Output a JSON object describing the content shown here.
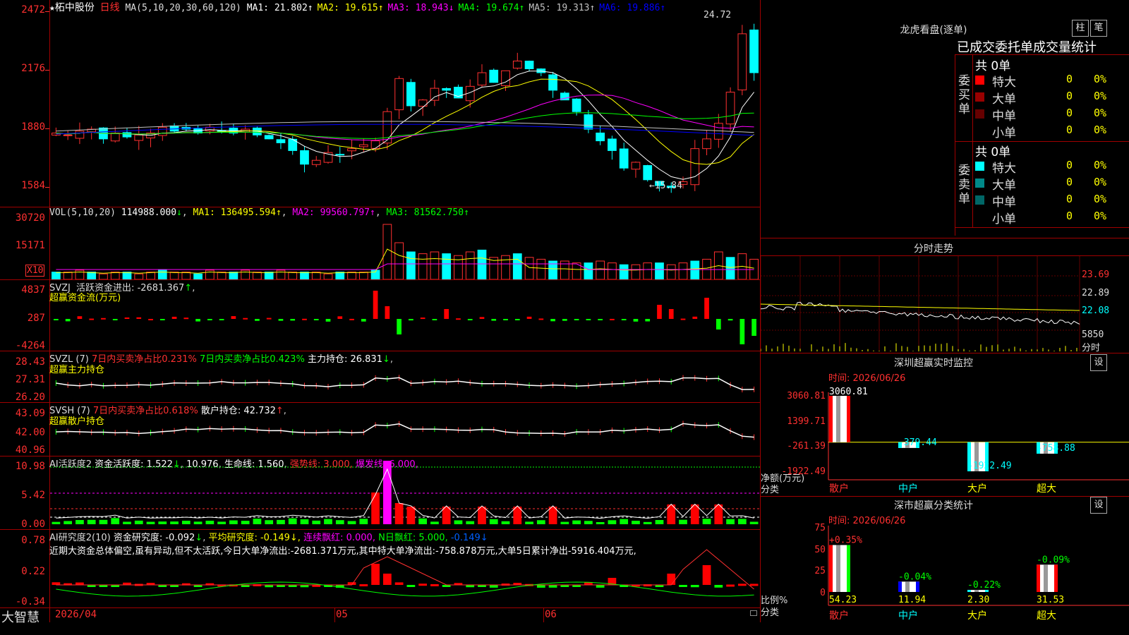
{
  "stock": {
    "name": "柘中股份",
    "period": "日线"
  },
  "main_chart": {
    "ma_params": "MA(5,10,20,30,60,120)",
    "ma_values": [
      {
        "label": "MA1:",
        "value": "21.802",
        "arrow": "↑",
        "color": "#ffffff"
      },
      {
        "label": "MA2:",
        "value": "19.615",
        "arrow": "↑",
        "color": "#ffff00"
      },
      {
        "label": "MA3:",
        "value": "18.943",
        "arrow": "↓",
        "color": "#ff00ff"
      },
      {
        "label": "MA4:",
        "value": "19.674",
        "arrow": "↑",
        "color": "#00ff00"
      },
      {
        "label": "MA5:",
        "value": "19.313",
        "arrow": "↑",
        "color": "#c0c0c0"
      },
      {
        "label": "MA6:",
        "value": "19.886",
        "arrow": "↑",
        "color": "#0000ff"
      }
    ],
    "y_ticks": [
      "2472",
      "2176",
      "1880",
      "1584"
    ],
    "high_label": "24.72",
    "low_label": "15.84"
  },
  "vol": {
    "title": "VOL(5,10,20)",
    "value": "114988.000",
    "ma1": "136495.594",
    "ma2": "99560.797",
    "ma3": "81562.750",
    "y_ticks": [
      "30720",
      "15171"
    ],
    "unit": "X10"
  },
  "svzj": {
    "title": "SVZJ",
    "label": "活跃资金进出:",
    "value": "-2681.367",
    "sub": "超赢资金流(万元)",
    "y_ticks": [
      "4837",
      "287",
      "-4264"
    ]
  },
  "svzl": {
    "title": "SVZL (7)",
    "t1": "7日内买卖净占比0.231%",
    "t2": "7日内买卖净占比0.423%",
    "t3": "主力持仓:",
    "v3": "26.831",
    "sub": "超赢主力持仓",
    "y_ticks": [
      "28.43",
      "27.31",
      "26.20"
    ]
  },
  "svsh": {
    "title": "SVSH (7)",
    "t1": "7日内买卖净占比0.618%",
    "t2": "散户持仓:",
    "v2": "42.732",
    "sub": "超赢散户持仓",
    "y_ticks": [
      "43.09",
      "42.00",
      "40.96"
    ]
  },
  "ai2": {
    "title": "AI活跃度2",
    "t1": "资金活跃度:",
    "v1": "1.522",
    "v2": "10.976",
    "t3": "生命线:",
    "v3": "1.560",
    "t4": "强势线:",
    "v4": "3.000",
    "t5": "爆发线:",
    "v5": "6.000",
    "y_ticks": [
      "10.98",
      "5.42",
      "0.00"
    ]
  },
  "ai_research": {
    "title": "AI研究度2(10)",
    "t1": "资金研究度:",
    "v1": "-0.092",
    "t2": "平均研究度:",
    "v2": "-0.149",
    "t3": "连续飘红:",
    "v3": "0.000",
    "t4": "N日飘红:",
    "v4": "5.000",
    "v5": "-0.149",
    "comment": "近期大资金总体偏空,虽有异动,但不太活跃,今日大单净流出:-2681.371万元,其中特大单净流出:-758.878万元,大单5日累计净出-5916.404万元,",
    "y_ticks": [
      "0.78",
      "0.22",
      "-0.34"
    ]
  },
  "bottom_bar": {
    "brand": "大智慧",
    "dates": [
      "2026/04",
      "05",
      "06"
    ]
  },
  "longhu": {
    "title": "龙虎看盘(逐单)",
    "btn1": "柱",
    "btn2": "笔",
    "header": "已成交委托单成交量统计",
    "buy_label": "委买单",
    "sell_label": "委卖单",
    "buy_total": "共 0单",
    "sell_total": "共 0单",
    "buy_rows": [
      {
        "name": "特大",
        "count": "0",
        "pct": "0%",
        "color": "#ff0000"
      },
      {
        "name": "大单",
        "count": "0",
        "pct": "0%",
        "color": "#990000"
      },
      {
        "name": "中单",
        "count": "0",
        "pct": "0%",
        "color": "#660000"
      },
      {
        "name": "小单",
        "count": "0",
        "pct": "0%",
        "color": "#000000"
      }
    ],
    "sell_rows": [
      {
        "name": "特大",
        "count": "0",
        "pct": "0%",
        "color": "#00ffff"
      },
      {
        "name": "大单",
        "count": "0",
        "pct": "0%",
        "color": "#008888"
      },
      {
        "name": "中单",
        "count": "0",
        "pct": "0%",
        "color": "#006666"
      },
      {
        "name": "小单",
        "count": "0",
        "pct": "0%",
        "color": "#000000"
      }
    ]
  },
  "fenshi": {
    "title": "分时走势",
    "y_ticks": [
      "23.69",
      "22.89",
      "22.08",
      "5850"
    ],
    "unit": "分时"
  },
  "sz_monitor": {
    "title": "深圳超赢实时监控",
    "btn": "设",
    "date": "时间: 2026/06/26",
    "y_ticks": [
      "3060.81",
      "1399.71",
      "-261.39",
      "-1922.49"
    ],
    "ylabel": "净额(万元)",
    "xlabel": "分类",
    "chart_data": {
      "type": "bar",
      "categories": [
        "散户",
        "中户",
        "大户",
        "超大"
      ],
      "values": [
        3060.81,
        -379.44,
        -1922.49,
        -758.88
      ],
      "value_labels": [
        "3060.81",
        "-379.44",
        "-1922.49",
        "-758.88"
      ],
      "ylim": [
        -1922.49,
        3060.81
      ]
    }
  },
  "sz_class": {
    "title": "深市超赢分类统计",
    "btn": "设",
    "date": "时间: 2026/06/26",
    "y_ticks": [
      "75",
      "50",
      "25",
      "0"
    ],
    "ylabel": "比例%",
    "xlabel": "分类",
    "chart_data": {
      "type": "bar",
      "categories": [
        "散户",
        "中户",
        "大户",
        "超大"
      ],
      "values": [
        54.23,
        11.94,
        2.3,
        31.53
      ],
      "value_labels": [
        "54.23",
        "11.94",
        "2.30",
        "31.53"
      ],
      "change_labels": [
        "+0.35%",
        "-0.04%",
        "-0.22%",
        "-0.09%"
      ],
      "ylim": [
        0,
        75
      ]
    }
  }
}
